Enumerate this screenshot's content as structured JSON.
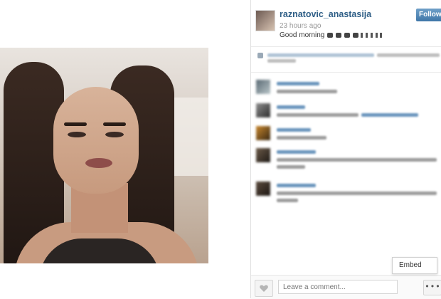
{
  "post": {
    "username": "raznatovic_anastasija",
    "follow_label": "Follow",
    "timestamp": "23 hours ago",
    "caption_text": "Good morning"
  },
  "composer": {
    "placeholder": "Leave a comment...",
    "more_label": "• • •"
  },
  "tooltip": {
    "embed_label": "Embed"
  },
  "icons": {
    "like": "heart-icon",
    "more": "ellipsis-icon",
    "profile": "avatar"
  },
  "colors": {
    "username": "#2e5e86",
    "follow_button": "#3f76a8"
  }
}
